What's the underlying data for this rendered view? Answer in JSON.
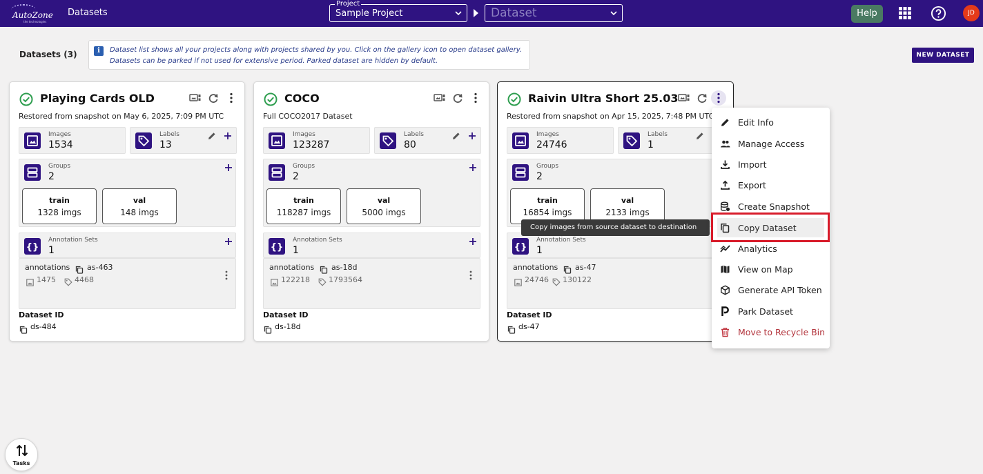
{
  "app": {
    "logo_text": "AutoZone",
    "logo_sub": "the technologies",
    "nav_label": "Datasets",
    "project_select": {
      "legend": "Project",
      "value": "Sample Project"
    },
    "dataset_select": {
      "value": "Dataset"
    },
    "help_label": "Help",
    "avatar_initials": "JD"
  },
  "page": {
    "title": "Datasets (3)",
    "info_icon": "i",
    "info_line1": "Dataset list shows all your projects along with projects shared by you. Click on the gallery icon to open dataset gallery.",
    "info_line2": "Datasets can be parked if not used for extensive period. Parked dataset are hidden by default.",
    "new_dataset_label": "NEW DATASET"
  },
  "labels": {
    "images": "Images",
    "labels": "Labels",
    "groups": "Groups",
    "annotation_sets": "Annotation Sets",
    "dataset_id": "Dataset ID"
  },
  "cards": [
    {
      "title": "Playing Cards OLD",
      "subtitle": "Restored from snapshot on May 6, 2025, 7:09 PM UTC",
      "images": "1534",
      "labels": "13",
      "groups": "2",
      "splits": [
        {
          "name": "train",
          "count": "1328 imgs"
        },
        {
          "name": "val",
          "count": "148 imgs"
        }
      ],
      "annotation_sets": "1",
      "annotation": {
        "name": "annotations",
        "id": "as-463",
        "images": "1475",
        "labels": "4468"
      },
      "dataset_id": "ds-484"
    },
    {
      "title": "COCO",
      "subtitle": "Full COCO2017 Dataset",
      "images": "123287",
      "labels": "80",
      "groups": "2",
      "splits": [
        {
          "name": "train",
          "count": "118287 imgs"
        },
        {
          "name": "val",
          "count": "5000 imgs"
        }
      ],
      "annotation_sets": "1",
      "annotation": {
        "name": "annotations",
        "id": "as-18d",
        "images": "122218",
        "labels": "1793564"
      },
      "dataset_id": "ds-18d"
    },
    {
      "title": "Raivin Ultra Short 25.03",
      "subtitle": "Restored from snapshot on Apr 15, 2025, 7:48 PM UTC",
      "images": "24746",
      "labels": "1",
      "groups": "2",
      "splits": [
        {
          "name": "train",
          "count": "16854 imgs"
        },
        {
          "name": "val",
          "count": "2133 imgs"
        }
      ],
      "annotation_sets": "1",
      "annotation": {
        "name": "annotations",
        "id": "as-47",
        "images": "24746",
        "labels": "130122"
      },
      "dataset_id": "ds-47"
    }
  ],
  "tooltip": "Copy images from source dataset to destination",
  "menu": [
    {
      "label": "Edit Info",
      "icon": "pencil-icon"
    },
    {
      "label": "Manage Access",
      "icon": "people-icon"
    },
    {
      "label": "Import",
      "icon": "download-icon"
    },
    {
      "label": "Export",
      "icon": "upload-icon"
    },
    {
      "label": "Create Snapshot",
      "icon": "database-icon"
    },
    {
      "label": "Copy Dataset",
      "icon": "copy-icon"
    },
    {
      "label": "Analytics",
      "icon": "analytics-icon"
    },
    {
      "label": "View on Map",
      "icon": "map-icon"
    },
    {
      "label": "Generate API Token",
      "icon": "cube-icon"
    },
    {
      "label": "Park Dataset",
      "icon": "parking-icon"
    },
    {
      "label": "Move to Recycle Bin",
      "icon": "trash-icon"
    }
  ],
  "tasks_label": "Tasks",
  "colors": {
    "primary": "#2f1381",
    "success": "#2e9e4f",
    "danger": "#b3353d",
    "help": "#4a7a62",
    "avatar": "#e53a1a",
    "highlight_border": "#d81b2a"
  }
}
